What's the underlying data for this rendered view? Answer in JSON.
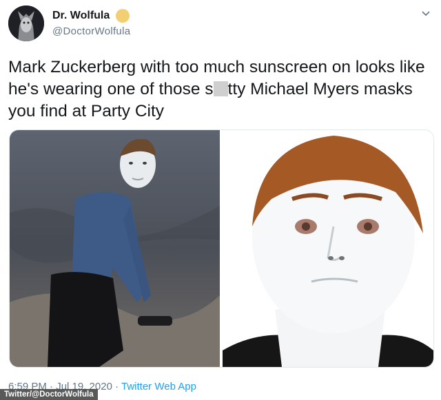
{
  "user": {
    "display_name": "Dr. Wolfula",
    "handle": "@DoctorWolfula",
    "badge_color": "#f3cf74"
  },
  "tweet": {
    "line1": "Mark Zuckerberg with too much sunscreen on looks like",
    "line2_before": "he's wearing one of those s",
    "line2_after": "tty Michael Myers masks",
    "line3": "you find at Party City"
  },
  "meta": {
    "time": "6:59 PM · Jul 19, 2020",
    "separator": " · ",
    "app": "Twitter Web App"
  },
  "watermark": "Twitter/@DoctorWolfula",
  "icons": {
    "menu": "chevron-down-icon"
  },
  "colors": {
    "link": "#1da1f2",
    "secondary_text": "#657786"
  }
}
